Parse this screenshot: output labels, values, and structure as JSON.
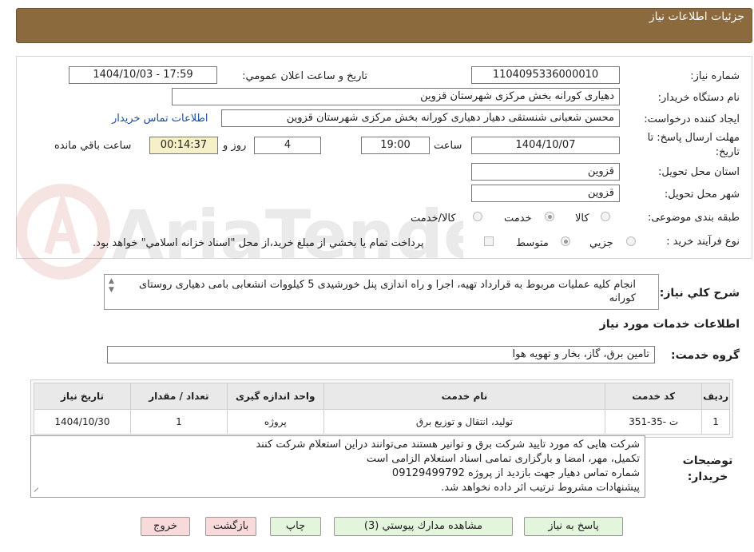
{
  "header": {
    "title": "جزئیات اطلاعات نیاز"
  },
  "form": {
    "need_number": {
      "label": "شماره نیاز:",
      "value": "1104095336000010"
    },
    "announce_datetime": {
      "label": "تاریخ و ساعت اعلان عمومي:",
      "value": "1404/10/03 - 17:59"
    },
    "buyer_org": {
      "label": "نام دستگاه خريدار:",
      "value": "دهیاری کورانه بخش مرکزی شهرستان قزوین"
    },
    "requester": {
      "label": "ايجاد کننده درخواست:",
      "value": "محسن شعبانی شنستقی دهیار دهیاری کورانه بخش مرکزی شهرستان قزوین"
    },
    "contact_link": "اطلاعات تماس خريدار",
    "deadline": {
      "label": "مهلت ارسال پاسخ: تا تاریخ:",
      "date": "1404/10/07",
      "time_label": "ساعت",
      "time": "19:00",
      "days": "4",
      "days_label": "روز و",
      "remaining": "00:14:37",
      "remaining_label": "ساعت باقي مانده"
    },
    "delivery_province": {
      "label": "استان محل تحويل:",
      "value": "قزوین"
    },
    "delivery_city": {
      "label": "شهر محل تحويل:",
      "value": "قزوین"
    },
    "category": {
      "label": "طبقه بندی موضوعی:",
      "options": [
        "کالا",
        "خدمت",
        "کالا/خدمت"
      ],
      "selected": "خدمت"
    },
    "purchase_process": {
      "label": "نوع فرآيند خريد :",
      "options": [
        "جزيي",
        "متوسط"
      ],
      "selected": "متوسط",
      "note": "پرداخت تمام يا بخشي از مبلغ خريد،از محل \"اسناد خزانه اسلامي\" خواهد بود."
    }
  },
  "summary": {
    "label": "شرح كلي نياز:",
    "text": "انجام کلیه عملیات مربوط به قرارداد تهیه، اجرا و راه اندازی پنل خورشیدی 5 کیلووات انشعابی بامی دهیاری روستای کورانه"
  },
  "services": {
    "title": "اطلاعات خدمات مورد نياز",
    "group_label": "گروه خدمت:",
    "group_value": "تامين برق، گاز، بخار و تهويه هوا",
    "columns": [
      "رديف",
      "کد خدمت",
      "نام خدمت",
      "واحد اندازه گيری",
      "تعداد / مقدار",
      "تاريخ نياز"
    ],
    "rows": [
      [
        "1",
        "ت -35-351",
        "توليد، انتقال و توزيع برق",
        "پروژه",
        "1",
        "1404/10/30"
      ]
    ]
  },
  "buyer_notes": {
    "label": "توضيحات خريدار:",
    "lines": [
      "شرکت هایی که مورد تایید شرکت برق و توانیر هستند می‌توانند دراین استعلام شرکت کنند",
      "تکمیل، مهر، امضا و بارگزاری تمامی اسناد استعلام الزامی است",
      "شماره تماس دهیار جهت بازدید از پروژه 09129499792",
      "پیشنهادات مشروط ترتیب اثر داده نخواهد شد."
    ]
  },
  "buttons": {
    "reply": "پاسخ به نياز",
    "attachments": "مشاهده مدارك پيوستي (3)",
    "print": "چاپ",
    "back": "بازگشت",
    "exit": "خروج"
  },
  "watermark": {
    "text": "AriaTender.neT"
  },
  "colors": {
    "header_bg": "#8b6a3e",
    "link": "#1a4fa0",
    "button_green": "#e3f5dc",
    "button_pink": "#f9dada",
    "highlight": "#f5f0c8"
  }
}
